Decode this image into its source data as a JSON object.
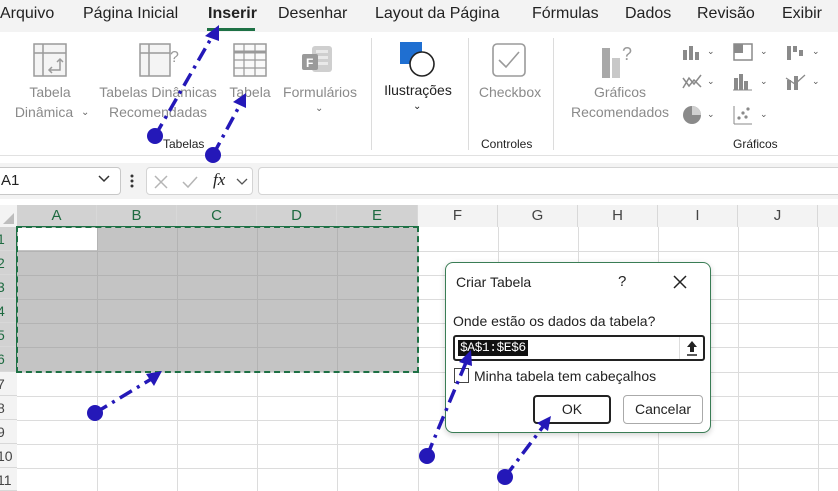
{
  "menu": [
    "Arquivo",
    "Página Inicial",
    "Inserir",
    "Desenhar",
    "Layout da Página",
    "Fórmulas",
    "Dados",
    "Revisão",
    "Exibir"
  ],
  "active_menu": "Inserir",
  "ribbon": {
    "tables": {
      "pivot_line1": "Tabela",
      "pivot_line2": "Dinâmica",
      "recommended_line1": "Tabelas Dinâmicas",
      "recommended_line2": "Recomendadas",
      "table": "Tabela",
      "forms": "Formulários",
      "group": "Tabelas"
    },
    "illustrations": "Ilustrações",
    "controls": {
      "checkbox": "Checkbox",
      "group": "Controles"
    },
    "charts": {
      "recommended_line1": "Gráficos",
      "recommended_line2": "Recomendados",
      "group": "Gráficos"
    }
  },
  "formula_bar": {
    "name_box": "A1",
    "fx": "fx",
    "formula": ""
  },
  "grid": {
    "columns": [
      "A",
      "B",
      "C",
      "D",
      "E",
      "F",
      "G",
      "H",
      "I",
      "J"
    ],
    "rows": [
      "1",
      "2",
      "3",
      "4",
      "5",
      "6",
      "7",
      "8",
      "9",
      "10",
      "11"
    ]
  },
  "dialog": {
    "title": "Criar Tabela",
    "help": "?",
    "question": "Onde estão os dados da tabela?",
    "range": "$A$1:$E$6",
    "checkbox_label": "Minha tabela tem cabeçalhos",
    "ok": "OK",
    "cancel": "Cancelar"
  },
  "colors": {
    "accent": "#1e7145",
    "selection": "#c4c4c4",
    "annotation": "#2418b8"
  }
}
